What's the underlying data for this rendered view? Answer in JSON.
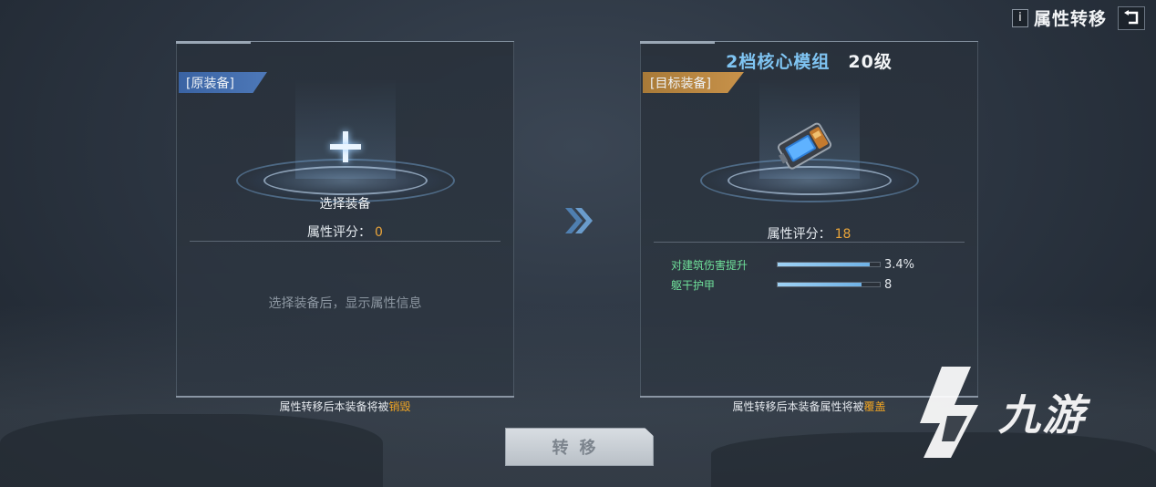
{
  "header": {
    "info_label": "i",
    "title": "属性转移"
  },
  "left_panel": {
    "tag": "[原装备]",
    "select_label": "选择装备",
    "score_label": "属性评分：",
    "score_value": "0",
    "placeholder": "选择装备后，显示属性信息",
    "note_prefix": "属性转移后本装备将被",
    "note_warn": "销毁"
  },
  "right_panel": {
    "module_name": "2档核心模组",
    "module_level": "20级",
    "tag": "[目标装备]",
    "score_label": "属性评分：",
    "score_value": "18",
    "stats": [
      {
        "name": "对建筑伤害提升",
        "value": "3.4%",
        "fill": 0.9
      },
      {
        "name": "躯干护甲",
        "value": "8",
        "fill": 0.82
      }
    ],
    "note_prefix": "属性转移后本装备属性将被",
    "note_warn": "覆盖"
  },
  "transfer_button": {
    "label": "转移"
  },
  "watermark": {
    "text": "九游"
  },
  "colors": {
    "accent_gold": "#f2a623",
    "stat_green": "#6fe09a",
    "module_blue": "#7fc4f2"
  }
}
